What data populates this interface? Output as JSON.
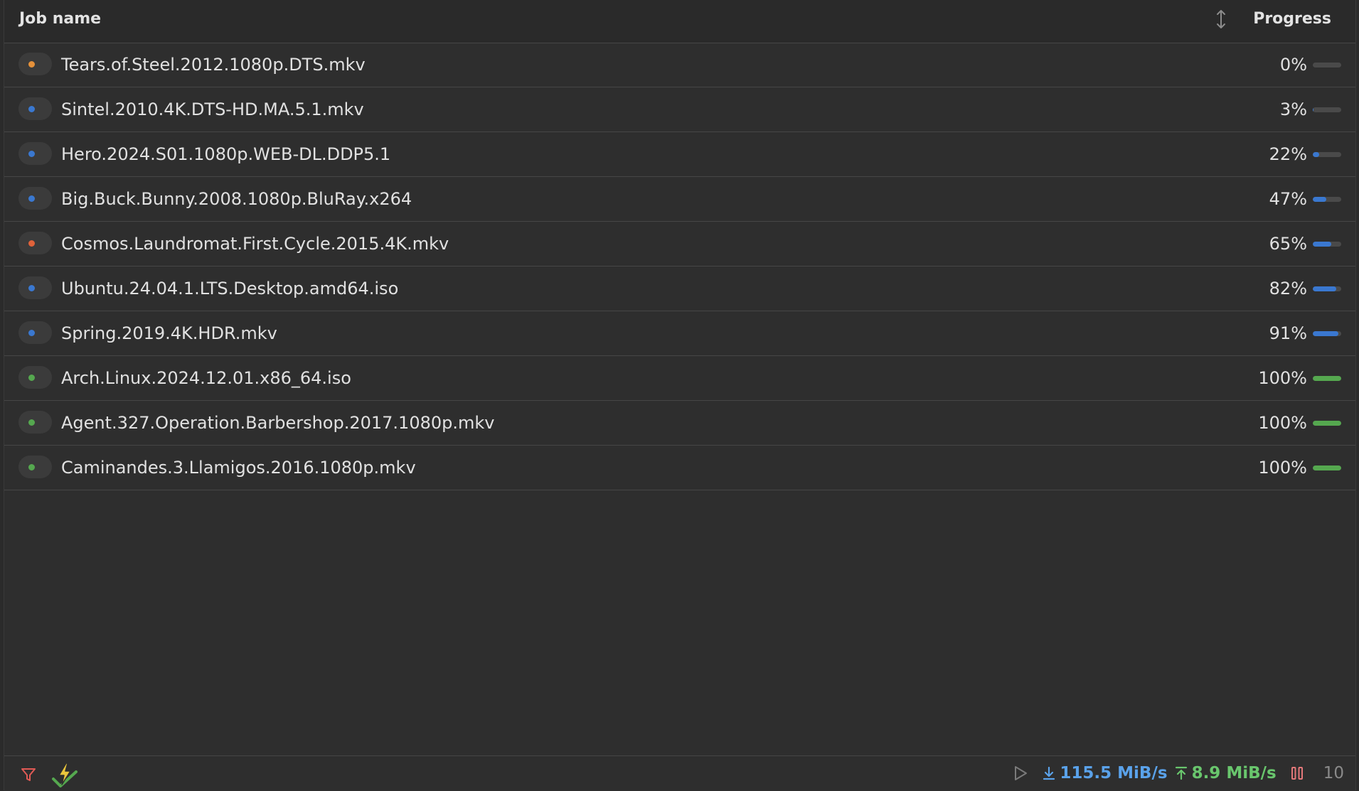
{
  "columns": {
    "name": "Job name",
    "progress": "Progress"
  },
  "colors": {
    "blue": "#3a78d0",
    "green": "#55a84f",
    "orange": "#e5913a",
    "red_orange": "#e0623a",
    "download": "#5aa2ea",
    "upload": "#69c66d",
    "pause": "#e4787a",
    "filter": "#e05a55"
  },
  "jobs": [
    {
      "name": "Tears.of.Steel.2012.1080p.DTS.mkv",
      "progress_label": "0%",
      "progress": 0,
      "status_color": "#e5913a",
      "bar_color": "#3a78d0"
    },
    {
      "name": "Sintel.2010.4K.DTS-HD.MA.5.1.mkv",
      "progress_label": "3%",
      "progress": 3,
      "status_color": "#3a78d0",
      "bar_color": "#3a78d0"
    },
    {
      "name": "Hero.2024.S01.1080p.WEB-DL.DDP5.1",
      "progress_label": "22%",
      "progress": 22,
      "status_color": "#3a78d0",
      "bar_color": "#3a78d0"
    },
    {
      "name": "Big.Buck.Bunny.2008.1080p.BluRay.x264",
      "progress_label": "47%",
      "progress": 47,
      "status_color": "#3a78d0",
      "bar_color": "#3a78d0"
    },
    {
      "name": "Cosmos.Laundromat.First.Cycle.2015.4K.mkv",
      "progress_label": "65%",
      "progress": 65,
      "status_color": "#e0623a",
      "bar_color": "#3a78d0"
    },
    {
      "name": "Ubuntu.24.04.1.LTS.Desktop.amd64.iso",
      "progress_label": "82%",
      "progress": 82,
      "status_color": "#3a78d0",
      "bar_color": "#3a78d0"
    },
    {
      "name": "Spring.2019.4K.HDR.mkv",
      "progress_label": "91%",
      "progress": 91,
      "status_color": "#3a78d0",
      "bar_color": "#3a78d0"
    },
    {
      "name": "Arch.Linux.2024.12.01.x86_64.iso",
      "progress_label": "100%",
      "progress": 100,
      "status_color": "#55a84f",
      "bar_color": "#55a84f"
    },
    {
      "name": "Agent.327.Operation.Barbershop.2017.1080p.mkv",
      "progress_label": "100%",
      "progress": 100,
      "status_color": "#55a84f",
      "bar_color": "#55a84f"
    },
    {
      "name": "Caminandes.3.Llamigos.2016.1080p.mkv",
      "progress_label": "100%",
      "progress": 100,
      "status_color": "#55a84f",
      "bar_color": "#55a84f"
    }
  ],
  "footer": {
    "download_speed": "115.5 MiB/s",
    "upload_speed": "8.9 MiB/s",
    "job_count": "10",
    "icons": [
      "filter-icon",
      "bolt-icon",
      "play-icon",
      "download-arrow-icon",
      "upload-arrow-icon",
      "pause-icon"
    ]
  }
}
